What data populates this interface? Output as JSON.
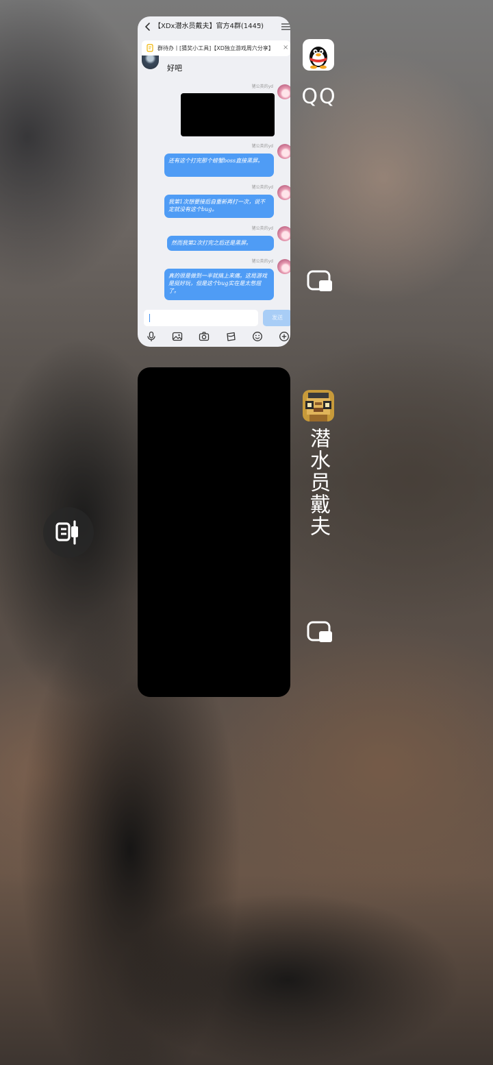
{
  "recents": {
    "qq_app": {
      "app_label": "QQ",
      "icon": "qq-penguin-icon",
      "chat": {
        "title": "【XDx潜水员戴夫】官方4群(1445)",
        "help_icon": "?",
        "todo": "群待办丨[猜奖小工具]【XD独立游戏周六分享】",
        "messages": [
          {
            "side": "left",
            "text": "好吧"
          },
          {
            "side": "right",
            "sender": "猪公英的yd",
            "type": "image-redacted"
          },
          {
            "side": "right",
            "sender": "猪公英的yd",
            "text": "还有这个打完那个螃蟹boss直接黑屏。"
          },
          {
            "side": "right",
            "sender": "猪公英的yd",
            "text": "我第1次想要接后自重新再打一次，说不定就没有这个bug。"
          },
          {
            "side": "right",
            "sender": "猪公英的yd",
            "text": "然而我第2次打完之后还是黑屏。"
          },
          {
            "side": "right",
            "sender": "猪公英的yd",
            "text": "真的很是做到一半就搞上来痛。这局游戏是挺好玩，但是这个bug实在是太憋屈了。"
          }
        ],
        "send_label": "发送",
        "toolbar": [
          "mic-icon",
          "image-icon",
          "camera-icon",
          "red-packet-icon",
          "emoji-icon",
          "plus-icon"
        ]
      }
    },
    "dave_app": {
      "app_label": "潜水员戴夫",
      "icon": "dave-pixel-icon"
    }
  },
  "side_button": {
    "icon": "split-screen-icon"
  },
  "colors": {
    "bubble": "#4f9cf5",
    "send": "#a8cdf6",
    "chat_bg": "#eff0f4"
  }
}
